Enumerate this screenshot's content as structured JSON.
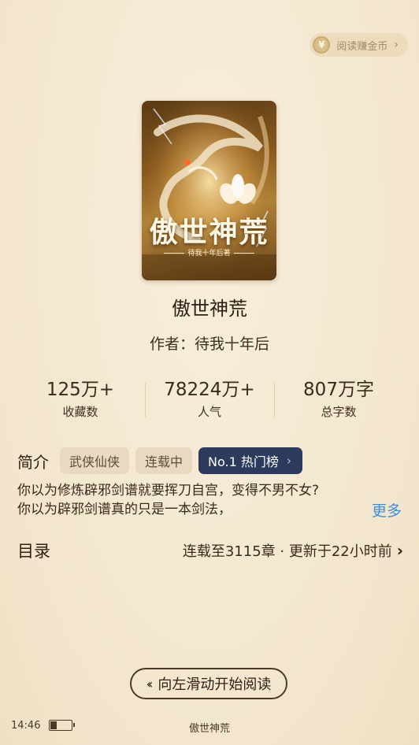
{
  "coin_pill": {
    "icon": "yen-coin-icon",
    "symbol": "¥",
    "label": "阅读赚金币",
    "chevron": "›"
  },
  "cover": {
    "title": "傲世神荒",
    "author_line": "待我十年后著"
  },
  "book": {
    "title": "傲世神荒",
    "author": "作者：待我十年后"
  },
  "stats": [
    {
      "value": "125万+",
      "label": "收藏数"
    },
    {
      "value": "78224万+",
      "label": "人气"
    },
    {
      "value": "807万字",
      "label": "总字数"
    }
  ],
  "intro": {
    "label": "简介",
    "tags": [
      "武侠仙侠",
      "连载中"
    ],
    "rank_tag": "No.1 热门榜",
    "rank_chevron": "›",
    "lines": [
      "你以为修炼辟邪剑谱就要挥刀自宫，变得不男不女?",
      "你以为辟邪剑谱真的只是一本剑法，"
    ],
    "more": "更多"
  },
  "toc": {
    "label": "目录",
    "info": "连载至3115章 · 更新于22小时前",
    "chevron": "›"
  },
  "swipe": {
    "arrows": "‹‹",
    "label": "向左滑动开始阅读"
  },
  "status": {
    "time": "14:46",
    "battery_level": 0.3,
    "footer_title": "傲世神荒"
  },
  "colors": {
    "background": "#f5ead4",
    "rank_tag": "#2c3a5c",
    "link": "#3b8ee0"
  }
}
